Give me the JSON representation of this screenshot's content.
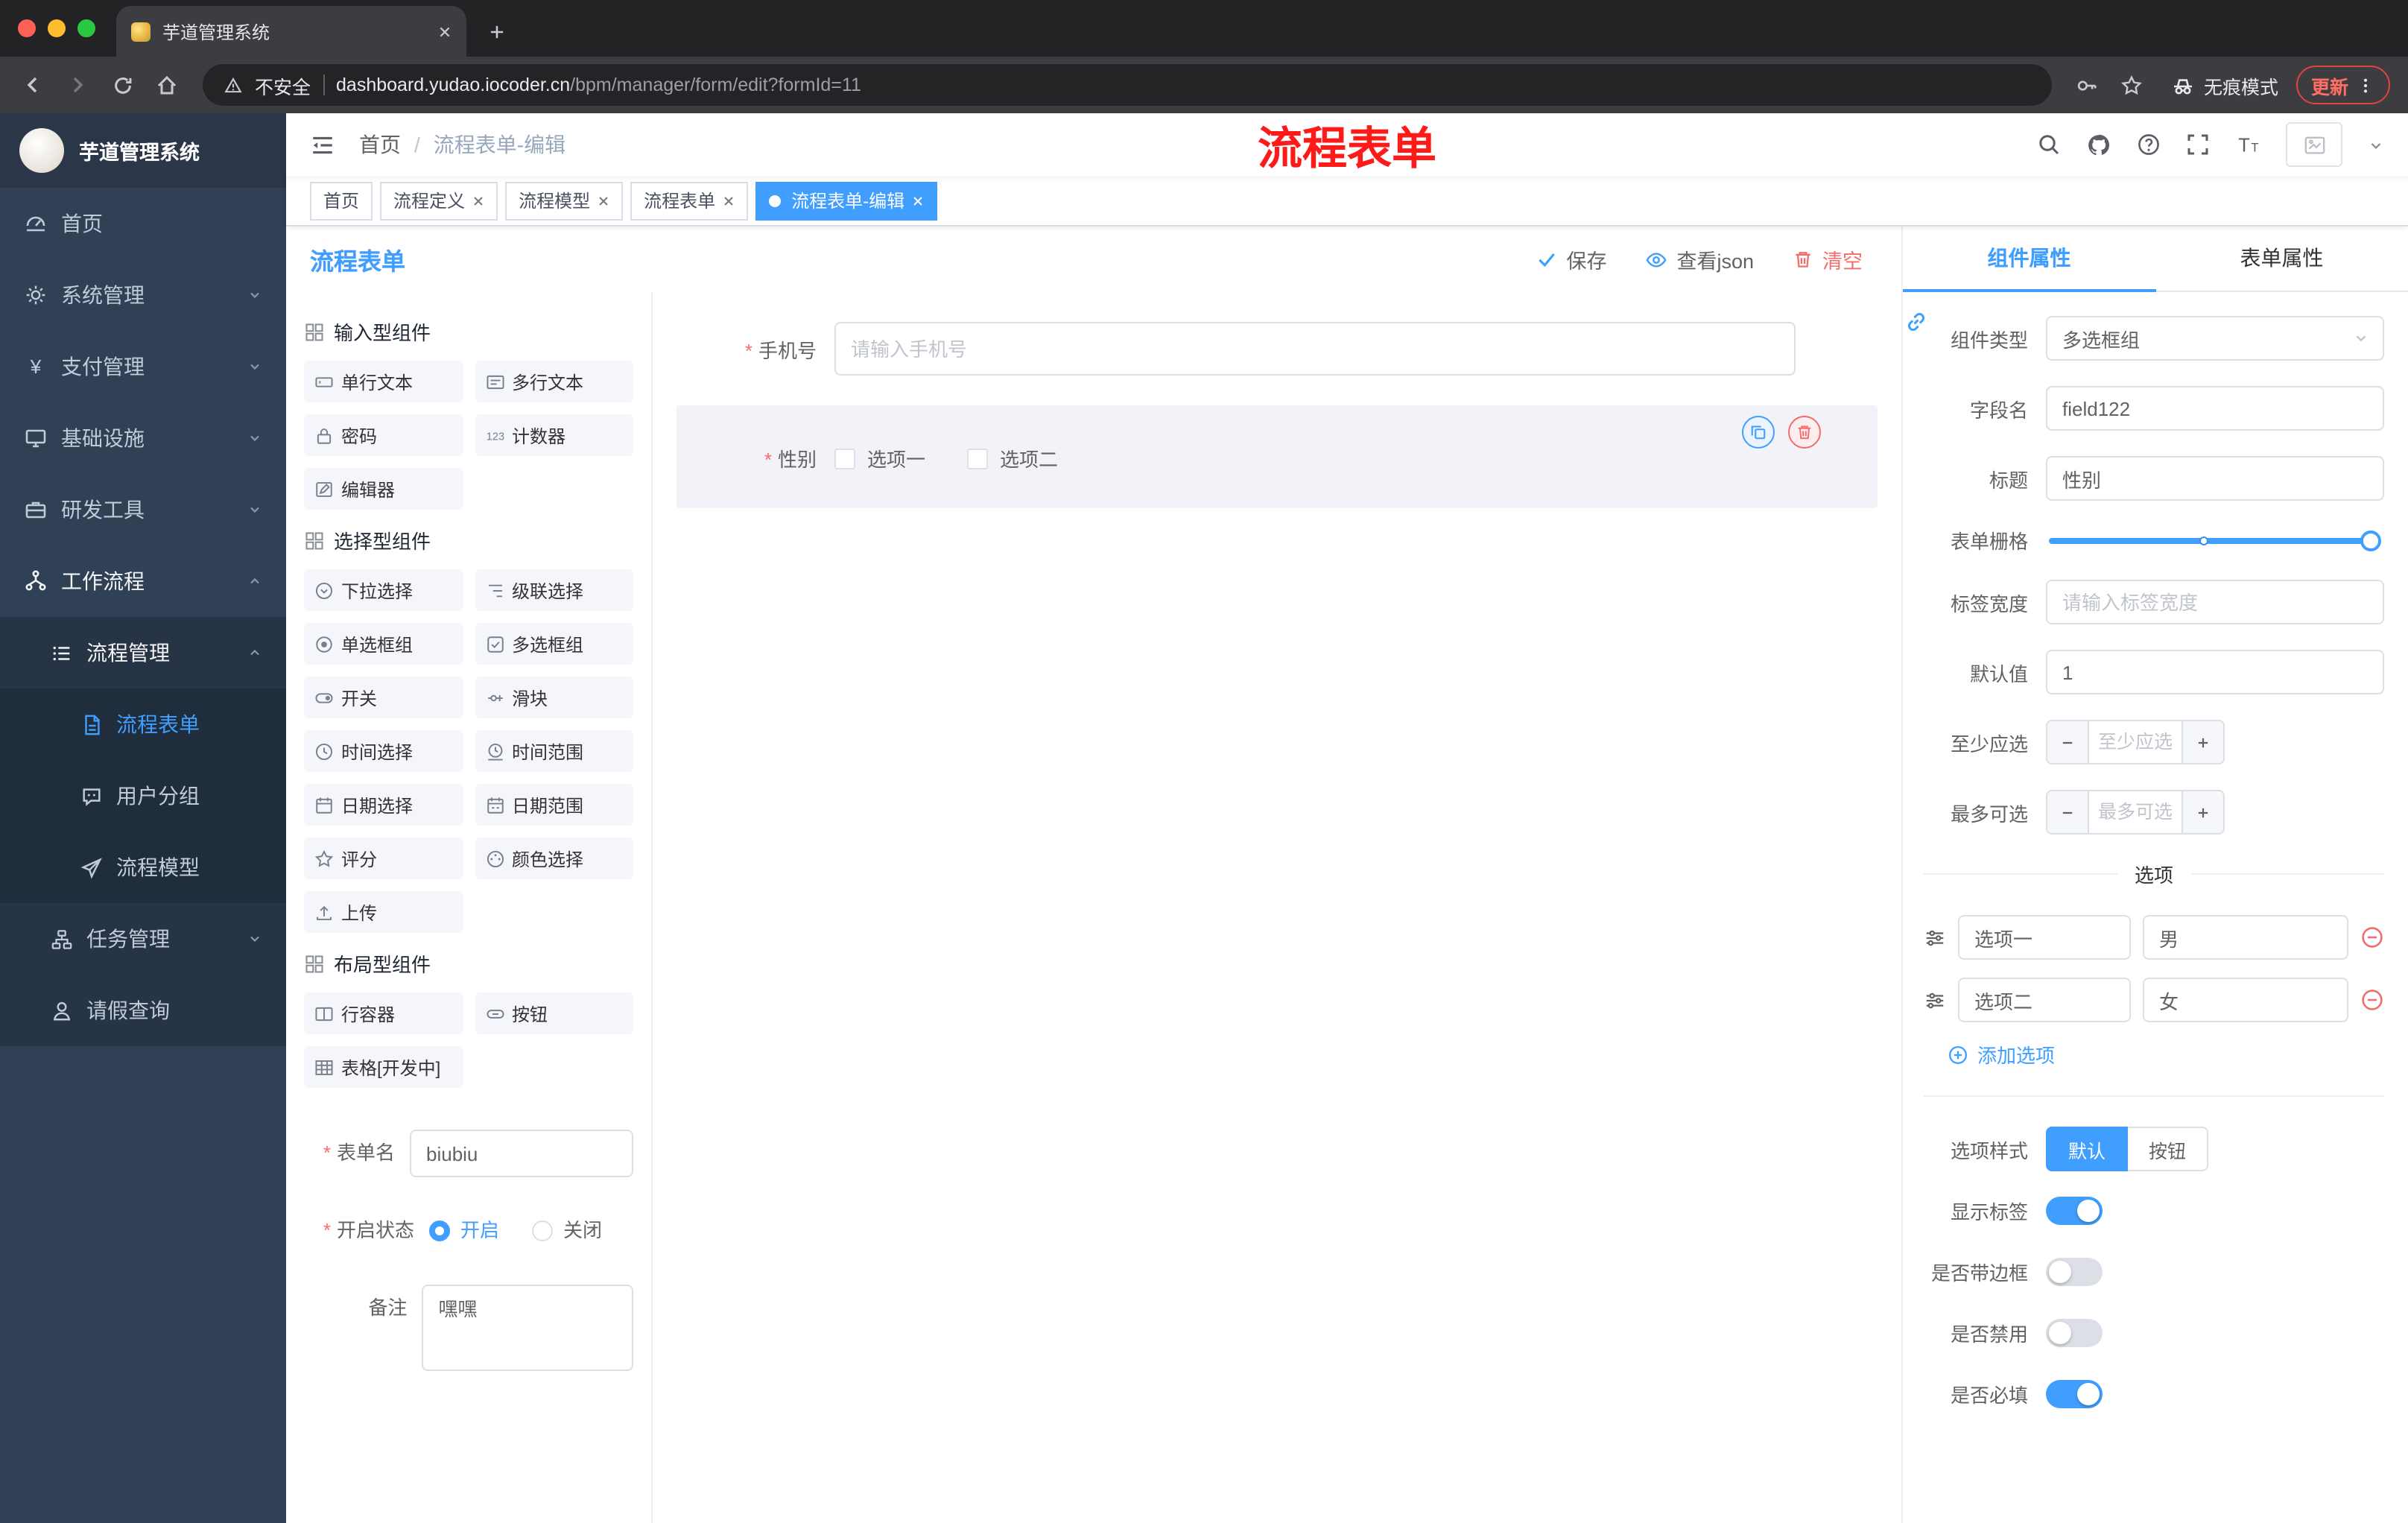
{
  "colors": {
    "accent": "#409eff",
    "danger": "#f56c6c",
    "sidebar_bg": "#304156",
    "tag_active": "#409eff",
    "annotation_red": "#ff1a1a"
  },
  "browser": {
    "tab_title": "芋道管理系统",
    "security_label": "不安全",
    "url_domain": "dashboard.yudao.iocoder.cn",
    "url_path": "/bpm/manager/form/edit?formId=11",
    "incognito_label": "无痕模式",
    "update_label": "更新"
  },
  "sidebar": {
    "app_title": "芋道管理系统",
    "items": [
      {
        "label": "首页"
      },
      {
        "label": "系统管理"
      },
      {
        "label": "支付管理"
      },
      {
        "label": "基础设施"
      },
      {
        "label": "研发工具"
      },
      {
        "label": "工作流程"
      },
      {
        "label": "流程管理"
      },
      {
        "label": "流程表单"
      },
      {
        "label": "用户分组"
      },
      {
        "label": "流程模型"
      },
      {
        "label": "任务管理"
      },
      {
        "label": "请假查询"
      }
    ]
  },
  "navbar": {
    "breadcrumb_home": "首页",
    "breadcrumb_current": "流程表单-编辑",
    "annotation_title": "流程表单"
  },
  "tags": [
    {
      "label": "首页"
    },
    {
      "label": "流程定义"
    },
    {
      "label": "流程模型"
    },
    {
      "label": "流程表单"
    },
    {
      "label": "流程表单-编辑"
    }
  ],
  "editor": {
    "title": "流程表单",
    "save_label": "保存",
    "view_json_label": "查看json",
    "clear_label": "清空"
  },
  "palette": {
    "group1_title": "输入型组件",
    "group2_title": "选择型组件",
    "group3_title": "布局型组件",
    "items1": [
      "单行文本",
      "多行文本",
      "密码",
      "计数器",
      "编辑器"
    ],
    "items2": [
      "下拉选择",
      "级联选择",
      "单选框组",
      "多选框组",
      "开关",
      "滑块",
      "时间选择",
      "时间范围",
      "日期选择",
      "日期范围",
      "评分",
      "颜色选择",
      "上传"
    ],
    "items3": [
      "行容器",
      "按钮",
      "表格[开发中]"
    ]
  },
  "form_meta": {
    "name_label": "表单名",
    "name_value": "biubiu",
    "status_label": "开启状态",
    "status_on": "开启",
    "status_off": "关闭",
    "remark_label": "备注",
    "remark_value": "嘿嘿"
  },
  "canvas": {
    "phone_label": "手机号",
    "phone_placeholder": "请输入手机号",
    "gender_label": "性别",
    "gender_option1": "选项一",
    "gender_option2": "选项二"
  },
  "props": {
    "tab_component": "组件属性",
    "tab_form": "表单属性",
    "type_label": "组件类型",
    "type_value": "多选框组",
    "field_label": "字段名",
    "field_value": "field122",
    "title_label": "标题",
    "title_value": "性别",
    "grid_label": "表单栅格",
    "width_label": "标签宽度",
    "width_placeholder": "请输入标签宽度",
    "default_label": "默认值",
    "default_value": "1",
    "min_label": "至少应选",
    "min_placeholder": "至少应选",
    "max_label": "最多可选",
    "max_placeholder": "最多可选",
    "options_title": "选项",
    "opt1_label": "选项一",
    "opt1_value": "男",
    "opt2_label": "选项二",
    "opt2_value": "女",
    "add_option_label": "添加选项",
    "style_label": "选项样式",
    "style_default": "默认",
    "style_button": "按钮",
    "toggle_show_label": "显示标签",
    "toggle_border_label": "是否带边框",
    "toggle_disabled_label": "是否禁用",
    "toggle_required_label": "是否必填"
  }
}
